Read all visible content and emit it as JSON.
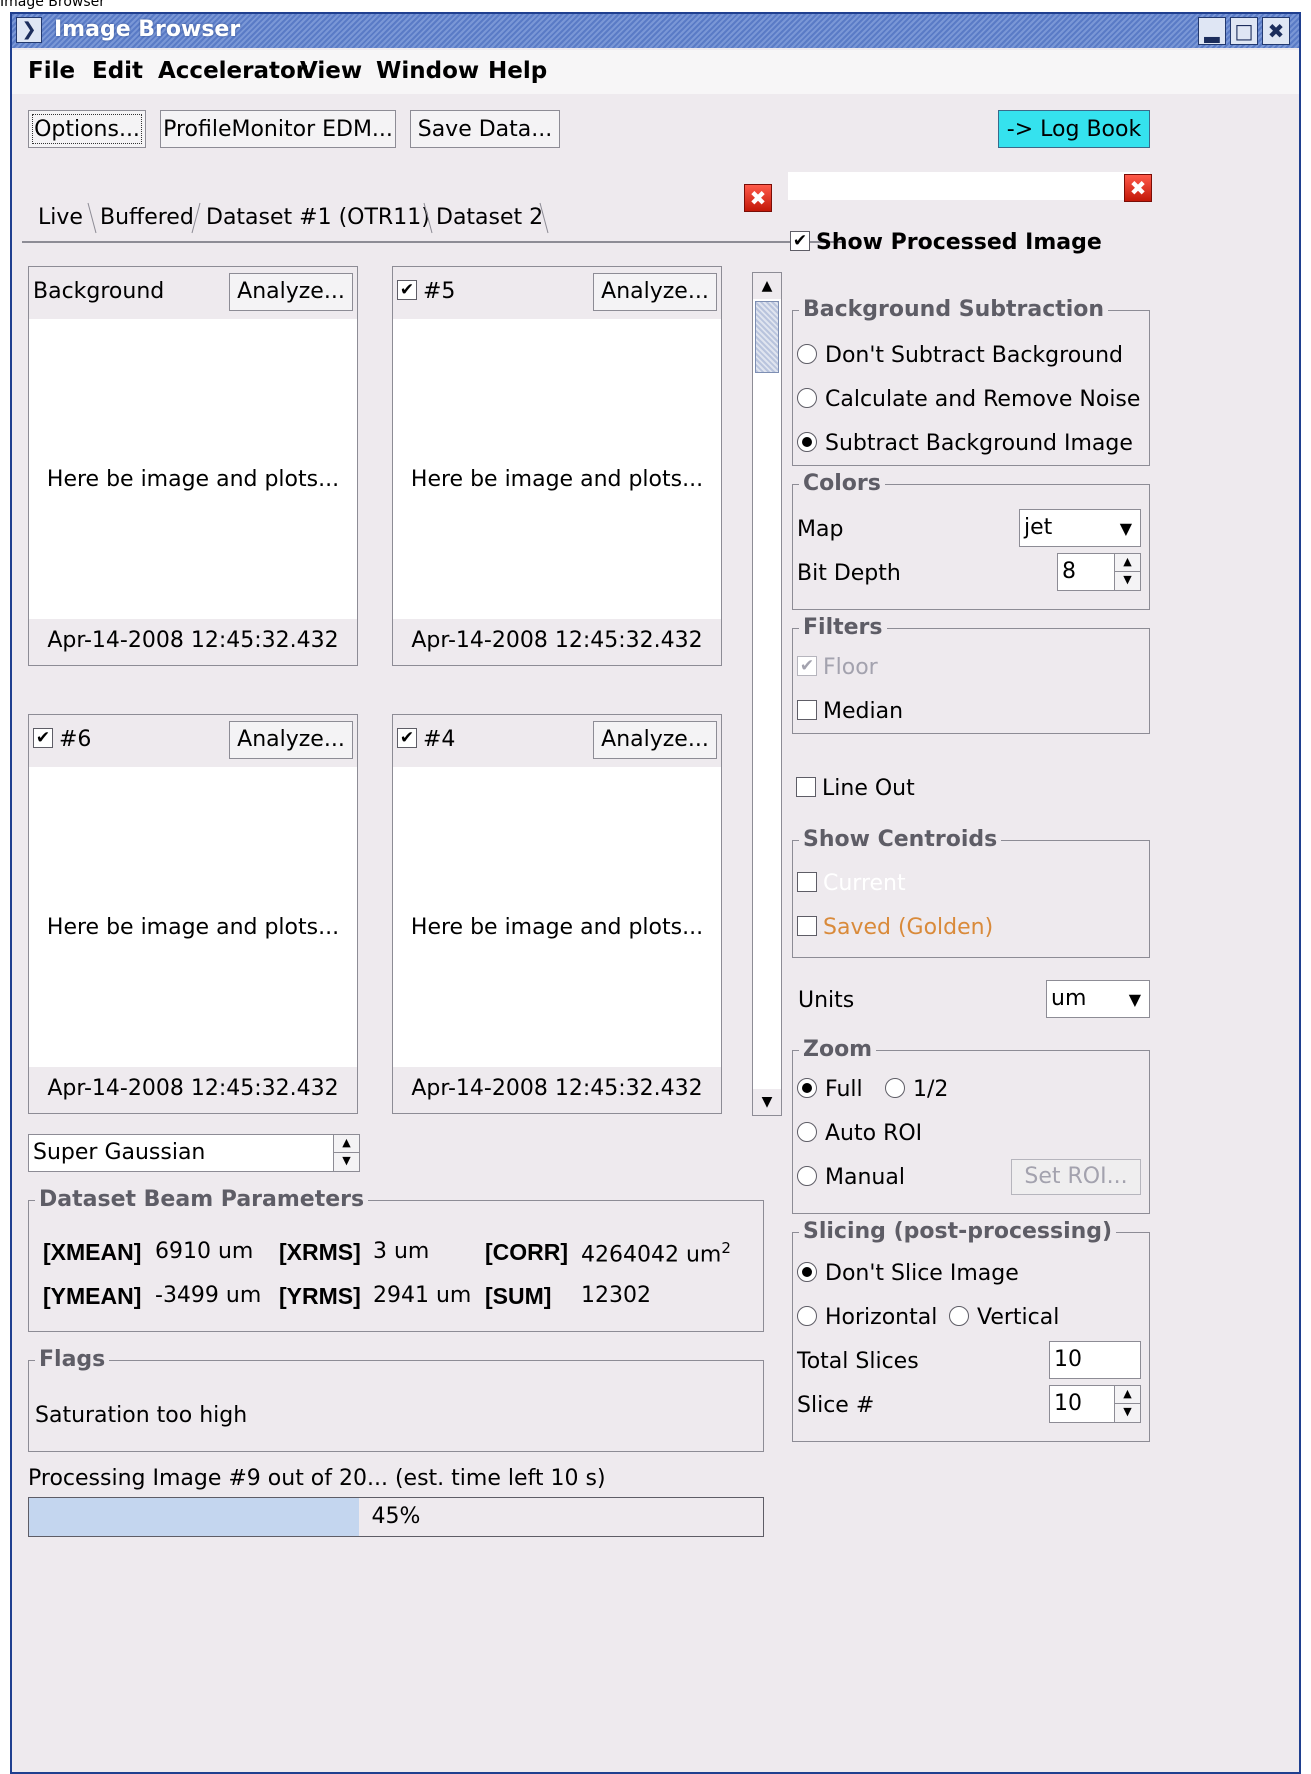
{
  "caption": "Image Browser",
  "window": {
    "title": "Image Browser"
  },
  "menu": [
    "File",
    "Edit",
    "Accelerator",
    "View",
    "Window",
    "Help"
  ],
  "toolbar": {
    "options": "Options...",
    "profile_monitor": "ProfileMonitor EDM...",
    "save_data": "Save Data...",
    "log_book": "-> Log Book"
  },
  "tabs": [
    "Live",
    "Buffered",
    "Dataset #1 (OTR11)",
    "Dataset 2"
  ],
  "active_tab": "Dataset #1 (OTR11)",
  "panels": [
    {
      "label": "Background",
      "checked": false,
      "button": "Analyze...",
      "message": "Here be image and plots...",
      "timestamp": "Apr-14-2008 12:45:32.432"
    },
    {
      "label": "#5",
      "checked": true,
      "button": "Analyze...",
      "message": "Here be image and plots...",
      "timestamp": "Apr-14-2008 12:45:32.432"
    },
    {
      "label": "#6",
      "checked": true,
      "button": "Analyze...",
      "message": "Here be image and plots...",
      "timestamp": "Apr-14-2008 12:45:32.432"
    },
    {
      "label": "#4",
      "checked": true,
      "button": "Analyze...",
      "message": "Here be image and plots...",
      "timestamp": "Apr-14-2008 12:45:32.432"
    }
  ],
  "fit_method": "Super Gaussian",
  "beam_params": {
    "title": "Dataset Beam Parameters",
    "xmean_label": "[XMEAN]",
    "xmean": "6910 um",
    "xrms_label": "[XRMS]",
    "xrms": "3 um",
    "corr_label": "[CORR]",
    "corr": "4264042 um",
    "corr_sup": "2",
    "ymean_label": "[YMEAN]",
    "ymean": "-3499 um",
    "yrms_label": "[YRMS]",
    "yrms": "2941 um",
    "sum_label": "[SUM]",
    "sum": "12302"
  },
  "flags": {
    "title": "Flags",
    "text": "Saturation too high"
  },
  "progress": {
    "label": "Processing Image #9 out of 20... (est. time left 10 s)",
    "value": 0.45,
    "text": "45%"
  },
  "right": {
    "show_processed": "Show Processed Image",
    "bg_title": "Background Subtraction",
    "bg_options": [
      "Don't Subtract Background",
      "Calculate and Remove Noise",
      "Subtract Background Image"
    ],
    "bg_selected": 2,
    "colors_title": "Colors",
    "map_label": "Map",
    "map_value": "jet",
    "bitdepth_label": "Bit Depth",
    "bitdepth_value": "8",
    "filters_title": "Filters",
    "floor_label": "Floor",
    "median_label": "Median",
    "lineout_label": "Line Out",
    "centroids_title": "Show Centroids",
    "current_label": "Current",
    "saved_label": "Saved (Golden)",
    "units_label": "Units",
    "units_value": "um",
    "zoom_title": "Zoom",
    "zoom_full": "Full",
    "zoom_half": "1/2",
    "zoom_auto": "Auto ROI",
    "zoom_manual": "Manual",
    "set_roi": "Set ROI...",
    "slicing_title": "Slicing (post-processing)",
    "slice_none": "Don't Slice Image",
    "slice_h": "Horizontal",
    "slice_v": "Vertical",
    "total_slices_label": "Total Slices",
    "total_slices_value": "10",
    "slice_num_label": "Slice #",
    "slice_num_value": "10"
  },
  "icons": {
    "title_menu": "chevron-down-icon",
    "minimize": "minimize-icon",
    "maximize": "maximize-icon",
    "close": "close-icon",
    "tab_close": "red-close-icon",
    "checkbox": "check-icon"
  },
  "colors": {
    "titlebar": "#5a7bc6",
    "log_book": "#35e2ee",
    "close_red": "#e0281a",
    "progress_fill": "#c4d6ef",
    "saved_golden": "#d98a3a"
  }
}
